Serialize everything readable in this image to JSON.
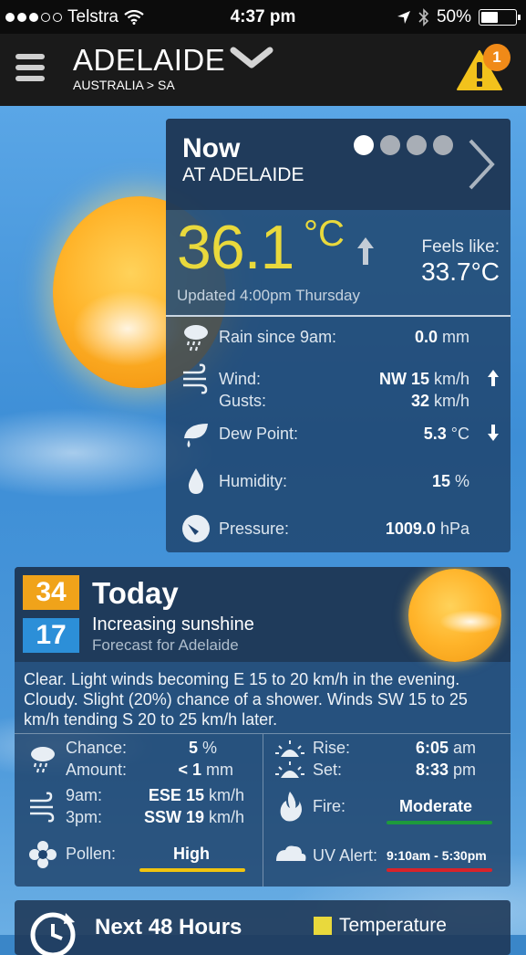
{
  "status_bar": {
    "carrier": "Telstra",
    "time": "4:37 pm",
    "battery_percent": "50%",
    "battery_level": 0.5
  },
  "header": {
    "city": "ADELAIDE",
    "region": "AUSTRALIA > SA",
    "alert_count": "1"
  },
  "now": {
    "title": "Now",
    "subtitle": "AT ADELAIDE",
    "pages_total": 4,
    "active_page": 0,
    "temperature": "36.1",
    "temp_unit": "°C",
    "feels_like_label": "Feels like:",
    "feels_like_value": "33.7°C",
    "updated": "Updated 4:00pm Thursday",
    "rain_label": "Rain since 9am:",
    "rain_value": "0.0",
    "rain_unit": "mm",
    "wind_label": "Wind:",
    "wind_value": "NW 15",
    "wind_unit": "km/h",
    "gusts_label": "Gusts:",
    "gusts_value": "32",
    "gusts_unit": "km/h",
    "dew_label": "Dew Point:",
    "dew_value": "5.3",
    "dew_unit": "°C",
    "humidity_label": "Humidity:",
    "humidity_value": "15",
    "humidity_unit": "%",
    "pressure_label": "Pressure:",
    "pressure_value": "1009.0",
    "pressure_unit": "hPa"
  },
  "today": {
    "max": "34",
    "min": "17",
    "title": "Today",
    "summary": "Increasing sunshine",
    "forecast_for": "Forecast for Adelaide",
    "details": "Clear. Light winds becoming E 15 to 20 km/h in the evening. Cloudy. Slight (20%) chance of a shower. Winds SW 15 to 25 km/h tending S 20 to 25 km/h later.",
    "chance_label": "Chance:",
    "chance_value": "5",
    "chance_unit": "%",
    "amount_label": "Amount:",
    "amount_value": "< 1",
    "amount_unit": "mm",
    "rise_label": "Rise:",
    "rise_value": "6:05",
    "rise_unit": "am",
    "set_label": "Set:",
    "set_value": "8:33",
    "set_unit": "pm",
    "wind9_label": "9am:",
    "wind9_value": "ESE 15",
    "wind9_unit": "km/h",
    "wind3_label": "3pm:",
    "wind3_value": "SSW 19",
    "wind3_unit": "km/h",
    "fire_label": "Fire:",
    "fire_value": "Moderate",
    "pollen_label": "Pollen:",
    "pollen_value": "High",
    "uv_label": "UV Alert:",
    "uv_value": "9:10am - 5:30pm"
  },
  "next48": {
    "title": "Next 48 Hours",
    "legend_label": "Temperature"
  },
  "colors": {
    "temp_yellow": "#e9d93c",
    "max_orange": "#f0a31a",
    "min_blue": "#2c8fd8",
    "fire_green": "#1e9a3c",
    "pollen_yellow": "#f1c40f",
    "uv_red": "#d8232a",
    "alert_orange": "#f08a18"
  }
}
